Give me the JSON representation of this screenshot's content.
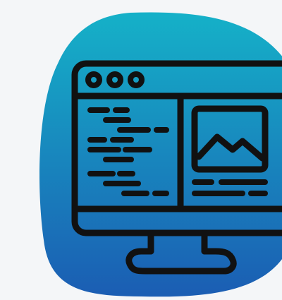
{
  "icon": {
    "name": "web-development-monitor-icon",
    "description_role": "app-icon",
    "gradient_colors": [
      "#1aa6c4",
      "#1a5fb4"
    ],
    "glyph_color": "#111111",
    "background_color": "#f4f6f8"
  }
}
